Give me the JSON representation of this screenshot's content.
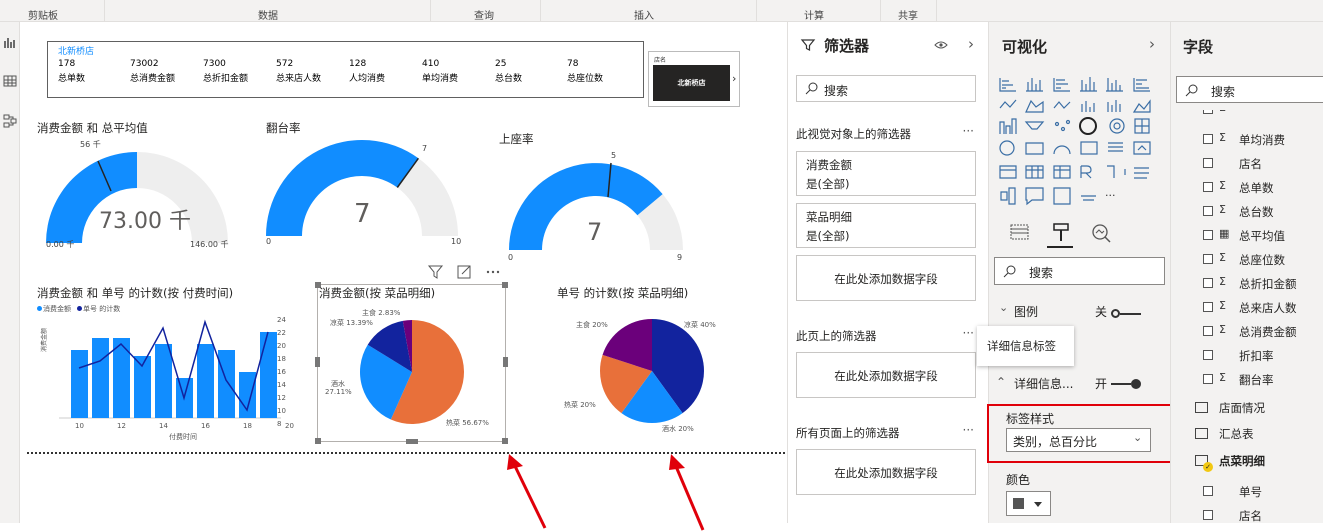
{
  "ribbon": {
    "groups": [
      "剪贴板",
      "数据",
      "查询",
      "插入",
      "计算",
      "共享"
    ]
  },
  "kpi": {
    "store": "北新桥店",
    "items": [
      {
        "value": "178",
        "label": "总单数"
      },
      {
        "value": "73002",
        "label": "总消费金额"
      },
      {
        "value": "7300",
        "label": "总折扣金额"
      },
      {
        "value": "572",
        "label": "总来店人数"
      },
      {
        "value": "128",
        "label": "人均消费"
      },
      {
        "value": "410",
        "label": "单均消费"
      },
      {
        "value": "25",
        "label": "总台数"
      },
      {
        "value": "78",
        "label": "总座位数"
      }
    ]
  },
  "slicer": {
    "title": "店名",
    "value": "北新桥店"
  },
  "gauge1": {
    "title": "消费金额 和 总平均值",
    "value_text": "73.00 千",
    "target_text": "56 千",
    "min": "0.00 千",
    "max": "146.00 千",
    "value": 73,
    "target": 56,
    "range": [
      0,
      146
    ]
  },
  "gauge2": {
    "title": "翻台率",
    "value_text": "7",
    "target_text": "7",
    "min": "0",
    "max": "10",
    "value": 7,
    "target": 7,
    "range": [
      0,
      10
    ]
  },
  "gauge3": {
    "title": "上座率",
    "value_text": "7",
    "target_text": "5",
    "min": "0",
    "max": "9",
    "value": 7,
    "target": 5,
    "range": [
      0,
      9
    ]
  },
  "combo": {
    "title": "消费金额 和 单号 的计数(按 付费时间)",
    "legend": [
      "消费金额",
      "单号 的计数"
    ],
    "ylabel": "消费金额",
    "xlabel": "付费时间",
    "x_ticks": [
      "10",
      "12",
      "14",
      "16",
      "18",
      "20"
    ],
    "y2_ticks": [
      "24",
      "22",
      "20",
      "18",
      "16",
      "14",
      "12",
      "10",
      "8"
    ]
  },
  "pie1": {
    "title": "消费金额(按 菜品明细)",
    "labels": [
      "主食 2.83%",
      "凉菜 13.39%",
      "酒水",
      "27.11%",
      "热菜 56.67%"
    ]
  },
  "pie2": {
    "title": "单号 的计数(按 菜品明细)",
    "labels": [
      "主食 20%",
      "凉菜 40%",
      "热菜 20%",
      "酒水 20%"
    ]
  },
  "chart_data": [
    {
      "type": "pie",
      "title": "消费金额(按 菜品明细)",
      "categories": [
        "热菜",
        "酒水",
        "凉菜",
        "主食"
      ],
      "values": [
        56.67,
        27.11,
        13.39,
        2.83
      ],
      "colors": [
        "#e8703a",
        "#118dff",
        "#12239e",
        "#6b007b"
      ]
    },
    {
      "type": "pie",
      "title": "单号 的计数(按 菜品明细)",
      "categories": [
        "凉菜",
        "酒水",
        "热菜",
        "主食"
      ],
      "values": [
        40,
        20,
        20,
        20
      ],
      "colors": [
        "#12239e",
        "#118dff",
        "#e8703a",
        "#6b007b"
      ]
    }
  ],
  "filters": {
    "title": "筛选器",
    "search": "搜索",
    "section_visual": "此视觉对象上的筛选器",
    "card1_name": "消费金额",
    "card1_value": "是(全部)",
    "card2_name": "菜品明细",
    "card2_value": "是(全部)",
    "add_field": "在此处添加数据字段",
    "section_page": "此页上的筛选器",
    "section_all": "所有页面上的筛选器"
  },
  "viz": {
    "title": "可视化",
    "search": "搜索",
    "legend_label": "图例",
    "legend_state": "关",
    "detail_label": "详细信息...",
    "detail_state": "开",
    "tooltip": "详细信息标签",
    "label_style": "标签样式",
    "label_style_value": "类别，总百分比",
    "color_label": "颜色"
  },
  "fields": {
    "title": "字段",
    "search": "搜索",
    "items": [
      {
        "sig": "Σ",
        "name": "单均消费"
      },
      {
        "sig": "",
        "name": "店名"
      },
      {
        "sig": "Σ",
        "name": "总单数"
      },
      {
        "sig": "Σ",
        "name": "总台数"
      },
      {
        "sig": "▦",
        "name": "总平均值"
      },
      {
        "sig": "Σ",
        "name": "总座位数"
      },
      {
        "sig": "Σ",
        "name": "总折扣金额"
      },
      {
        "sig": "Σ",
        "name": "总来店人数"
      },
      {
        "sig": "Σ",
        "name": "总消费金额"
      },
      {
        "sig": "",
        "name": "折扣率"
      },
      {
        "sig": "Σ",
        "name": "翻台率"
      }
    ],
    "tables": [
      "店面情况",
      "汇总表",
      "点菜明细"
    ],
    "sub_items": [
      "单号",
      "店名"
    ]
  },
  "colors": {
    "accent": "#118dff",
    "red": "#e0000a",
    "gauge_bg": "#eeeeee"
  }
}
